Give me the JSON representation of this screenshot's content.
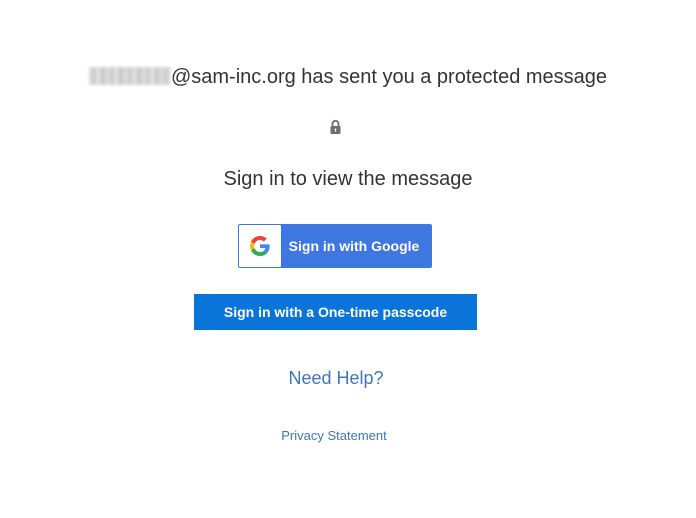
{
  "header": {
    "sender_domain_text": "@sam-inc.org has sent you a protected message"
  },
  "icons": {
    "lock": "lock-icon",
    "google": "google-g-icon"
  },
  "main": {
    "subtitle": "Sign in to view the message",
    "google_button_label": "Sign in with Google",
    "otp_button_label": "Sign in with a One-time passcode",
    "need_help_link": "Need Help?",
    "privacy_link": "Privacy Statement"
  },
  "colors": {
    "google_button": "#3f77e0",
    "otp_button": "#0b74d8",
    "link": "#3c77b9",
    "text": "#333333"
  }
}
